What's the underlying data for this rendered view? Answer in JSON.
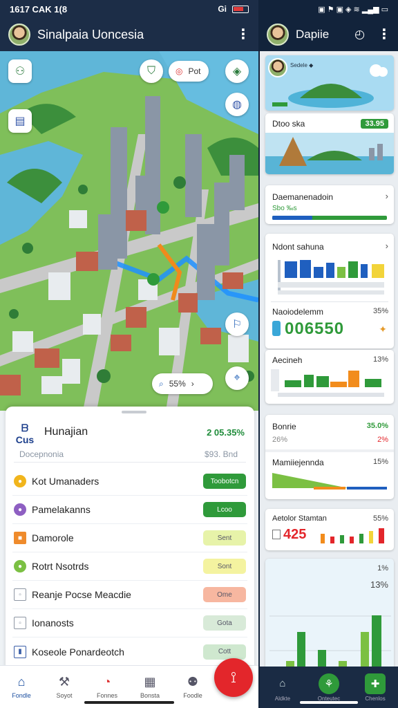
{
  "status": {
    "time": "1617 CAK 1(8",
    "signal": "Gi"
  },
  "appbar": {
    "title": "Sinalpaia Uoncesia"
  },
  "map": {
    "top_pill": "Pot",
    "bottom_pill": "55%",
    "buttons": [
      "person-add-icon",
      "shield-icon",
      "target-icon",
      "compass-icon",
      "map-icon",
      "nav-icon",
      "location-icon"
    ]
  },
  "sheet": {
    "logo": "ᗷ Cus",
    "name": "Hunajian",
    "value": "2  05.35%",
    "sub_left": "Docepnonia",
    "sub_right": "$93. Bnd",
    "items": [
      {
        "label": "Kot Umanaders",
        "tag": "Toobotcn",
        "icon_color": "#f1b51c",
        "tag_color": "#2f9a3a"
      },
      {
        "label": "Pamelakanns",
        "tag": "Lcoo",
        "icon_color": "#8e5fc2",
        "tag_color": "#2f9a3a"
      },
      {
        "label": "Damorole",
        "tag": "Sent",
        "icon_color": "#ef8b2c",
        "tag_color": "#e7f3a9"
      },
      {
        "label": "Rotrt Nsotrds",
        "tag": "Sont",
        "icon_color": "#7bc043",
        "tag_color": "#f4f3a0"
      },
      {
        "label": "Reanje Pocse Meacdie",
        "tag": "Ome",
        "icon_color": "#8d96a3",
        "tag_color": "#f7b7a0"
      },
      {
        "label": "Ionanosts",
        "tag": "Gota",
        "icon_color": "#8d96a3",
        "tag_color": "#d8ead8"
      },
      {
        "label": "Koseole Ponardeotch",
        "tag": "Cott",
        "icon_color": "#3a5ea8",
        "tag_color": "#cfe8cf"
      }
    ]
  },
  "tabbar": {
    "tabs": [
      {
        "label": "Fondle",
        "icon": "home-icon"
      },
      {
        "label": "Soyot",
        "icon": "tools-icon"
      },
      {
        "label": "Fonnes",
        "icon": "chart-icon"
      },
      {
        "label": "Bonsta",
        "icon": "calc-icon"
      },
      {
        "label": "Foodle",
        "icon": "people-icon"
      }
    ]
  },
  "right": {
    "title": "Dapiie",
    "cards": {
      "hero": {
        "label": "Sedele ◆"
      },
      "photo": {
        "title": "Dtoo ska",
        "value": "33.95"
      },
      "progress": {
        "title": "Daemanenadoin",
        "sub": "Sbo ‰s"
      },
      "bars1": {
        "title": "Ndont sahuna"
      },
      "stat": {
        "title": "Naoiodelemm",
        "value": "35%",
        "big": "006550"
      },
      "bars2": {
        "title": "Aecineh",
        "value": "13%"
      },
      "mini": {
        "title": "Bonrie",
        "value": "35.0%",
        "sub": "26%",
        "sub_value": "2%"
      },
      "area": {
        "title": "Mamiiejennda",
        "value": "15%"
      },
      "bars3": {
        "title": "Aetolor Stamtan",
        "value": "55%",
        "big": "425"
      },
      "tall": {
        "title": "13%",
        "small": "1%"
      }
    },
    "tabs": [
      "Aldkte",
      "Onteutec",
      "Chenlos"
    ]
  },
  "colors": {
    "navy": "#1c2d47",
    "green": "#2f9a3a",
    "red": "#e3262b",
    "blue": "#1f5fbf"
  }
}
